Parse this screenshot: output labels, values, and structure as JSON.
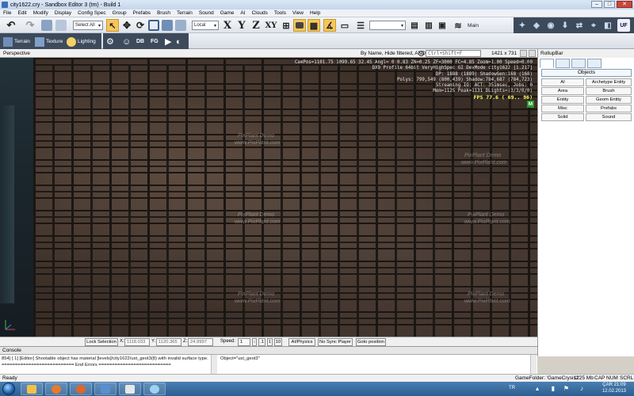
{
  "window": {
    "title": "city1622.cry - Sandbox Editor 3 (tm) - Build 1",
    "minimize": "–",
    "maximize": "□",
    "close": "✕"
  },
  "menu": [
    "File",
    "Edit",
    "Modify",
    "Display",
    "Config Spec",
    "Group",
    "Prefabs",
    "Brush",
    "Terrain",
    "Sound",
    "Game",
    "AI",
    "Clouds",
    "Tools",
    "View",
    "Help"
  ],
  "toolbar1": {
    "select_all": "Select All",
    "coord_system": "Local",
    "axes": [
      "X",
      "Y",
      "Z",
      "XY"
    ],
    "layer": "Main",
    "uf": "UF"
  },
  "toolbar2": {
    "terrain": "Terrain",
    "texture": "Texture",
    "lighting": "Lighting",
    "db": "DB",
    "fg": "FG"
  },
  "viewport": {
    "name": "Perspective",
    "filter": "By Name, Hide filtered, AND",
    "search_placeholder": "Ctrl+Shift+F",
    "resolution": "1421 x 731",
    "hud": [
      "CamPos=1101.75 1099.65 32.45 Angl=  0  0.83 ZN=0.25 ZF=3000 FC=4.85 Zoom=1.00 Speed=0.00",
      "DX9 Profile 64bit VeryHighSpec GI DevMode city1622 [1.217]",
      "DP: 1888 (1889) ShadowGen:168 (168)",
      "Polys: 799,549 (800,439) Shadow:784,687 (784,723)",
      "Streaming IO: ACT: 351msec, Jobs: 0",
      "Mem=1125 Peak=1131 DLights=(3/3/0/0)"
    ],
    "fps": "FPS 77.6 ( 69.. 96)",
    "mode_badge": "M",
    "watermark_demo": "PixPlant Demo",
    "watermark_site": "www.PixPlant.com"
  },
  "viewport_status": {
    "lock_selection": "Lock Selection",
    "x_label": "X:",
    "x_value": "1118.033",
    "y_label": "Y:",
    "y_value": "1120.365",
    "z_label": "Z:",
    "z_value": "24.9997",
    "speed_label": "Speed:",
    "speed_value": "1",
    "speed_presets": [
      ".1",
      "1",
      "10"
    ],
    "ai_physics": "AI/Physics",
    "no_sync": "No Sync Player",
    "goto": "Goto position"
  },
  "rollup": {
    "title": "RollupBar",
    "objects_header": "Objects",
    "buttons": [
      "AI",
      "Archetype Entity",
      "Area",
      "Brush",
      "Entity",
      "Geom Entity",
      "Misc",
      "Prefabs",
      "Solid",
      "Sound"
    ]
  },
  "console": {
    "title": "Console",
    "lines": [
      "854] [ 1] [Editor]   Shootable object has material [levels]/city1622/ust_geot3(8) with invalid surface type.",
      "=========================== End Errors ==========================="
    ],
    "right_lines": [
      "Object=\"ust_geot3\""
    ]
  },
  "statusbar": {
    "ready": "Ready",
    "game_folder": "GameFolder: 'GameCrysis2'",
    "memory": "1125 Mb",
    "cap": "CAP",
    "num": "NUM",
    "scrl": "SCRL"
  },
  "taskbar": {
    "lang": "TR",
    "time": "21:09",
    "day": "ÇAR",
    "date": "12.02.2013"
  },
  "colors": {
    "accent_blue": "#2c5e90",
    "hud_text": "#e8e8e8",
    "fps_text": "#ffff66"
  }
}
